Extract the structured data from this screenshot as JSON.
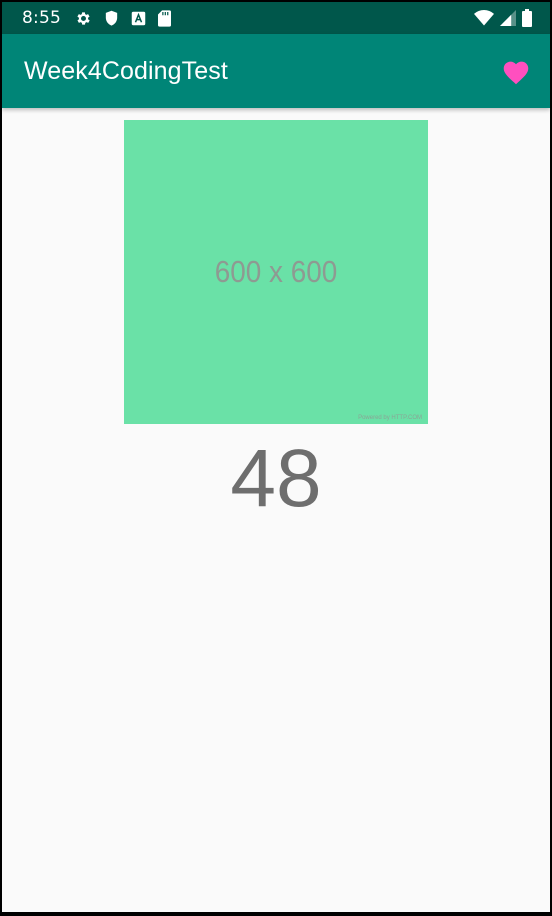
{
  "status_bar": {
    "time": "8:55",
    "left_icons": [
      "gear-icon",
      "shield-icon",
      "font-a-icon",
      "sd-card-icon"
    ],
    "right_icons": [
      "wifi-icon",
      "signal-icon",
      "battery-icon"
    ]
  },
  "app_bar": {
    "title": "Week4CodingTest",
    "action_icon": "heart-icon",
    "action_color": "#ff4fbf"
  },
  "colors": {
    "status_bar": "#00574B",
    "app_bar": "#008577",
    "image_bg": "#6ae1a7",
    "background": "#fafafa"
  },
  "image": {
    "label": "600 x 600",
    "credit": "Powered by HTTP.COM"
  },
  "counter": {
    "value": "48"
  }
}
